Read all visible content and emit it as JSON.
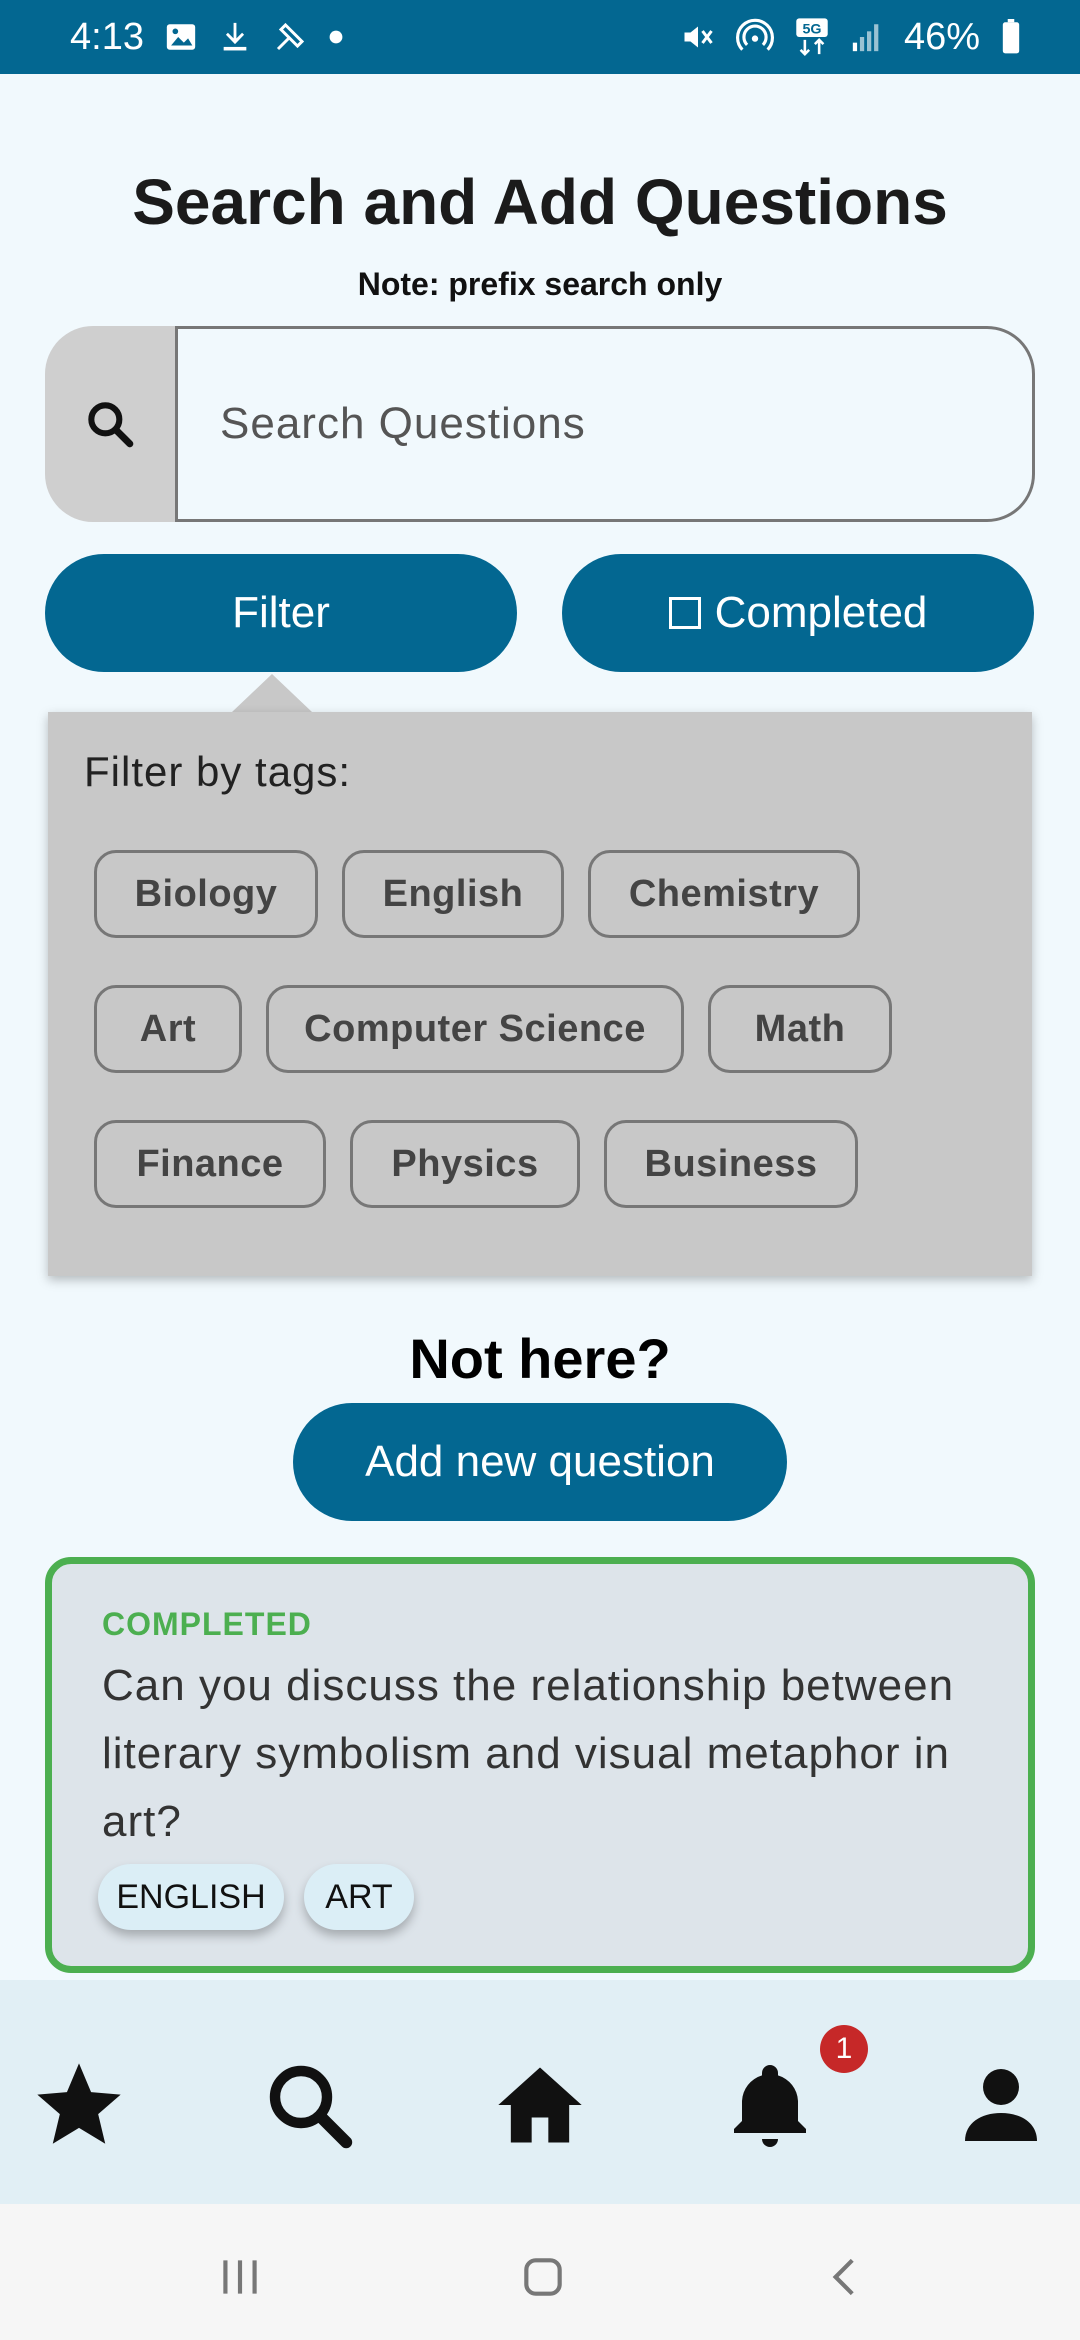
{
  "status_bar": {
    "time": "4:13",
    "battery": "46%",
    "network": "5G",
    "left_icons": [
      "image-icon",
      "download-icon",
      "mute-tools-icon",
      "dot-icon"
    ],
    "right_icons": [
      "mute-icon",
      "hotspot-icon",
      "5g-icon",
      "signal-icon",
      "battery-icon"
    ]
  },
  "header": {
    "title": "Search and Add Questions",
    "note": "Note: prefix search only"
  },
  "search": {
    "placeholder": "Search Questions",
    "value": ""
  },
  "buttons": {
    "filter_label": "Filter",
    "completed_label": "Completed",
    "completed_checked": false
  },
  "filter_popup": {
    "label": "Filter by tags:",
    "tags": [
      "Biology",
      "English",
      "Chemistry",
      "Art",
      "Computer Science",
      "Math",
      "Finance",
      "Physics",
      "Business"
    ]
  },
  "not_here": {
    "heading": "Not here?",
    "add_button": "Add new question"
  },
  "question_card": {
    "status": "COMPLETED",
    "question": "Can you discuss the relationship between literary symbolism and visual metaphor in art?",
    "tags": [
      "ENGLISH",
      "ART"
    ]
  },
  "bottom_nav": {
    "items": [
      "star-icon",
      "search-icon",
      "home-icon",
      "bell-icon",
      "profile-icon"
    ],
    "notification_count": "1"
  },
  "colors": {
    "primary": "#036791",
    "completed_green": "#4caf50",
    "badge_red": "#c62828",
    "background": "#f1f9fd"
  }
}
